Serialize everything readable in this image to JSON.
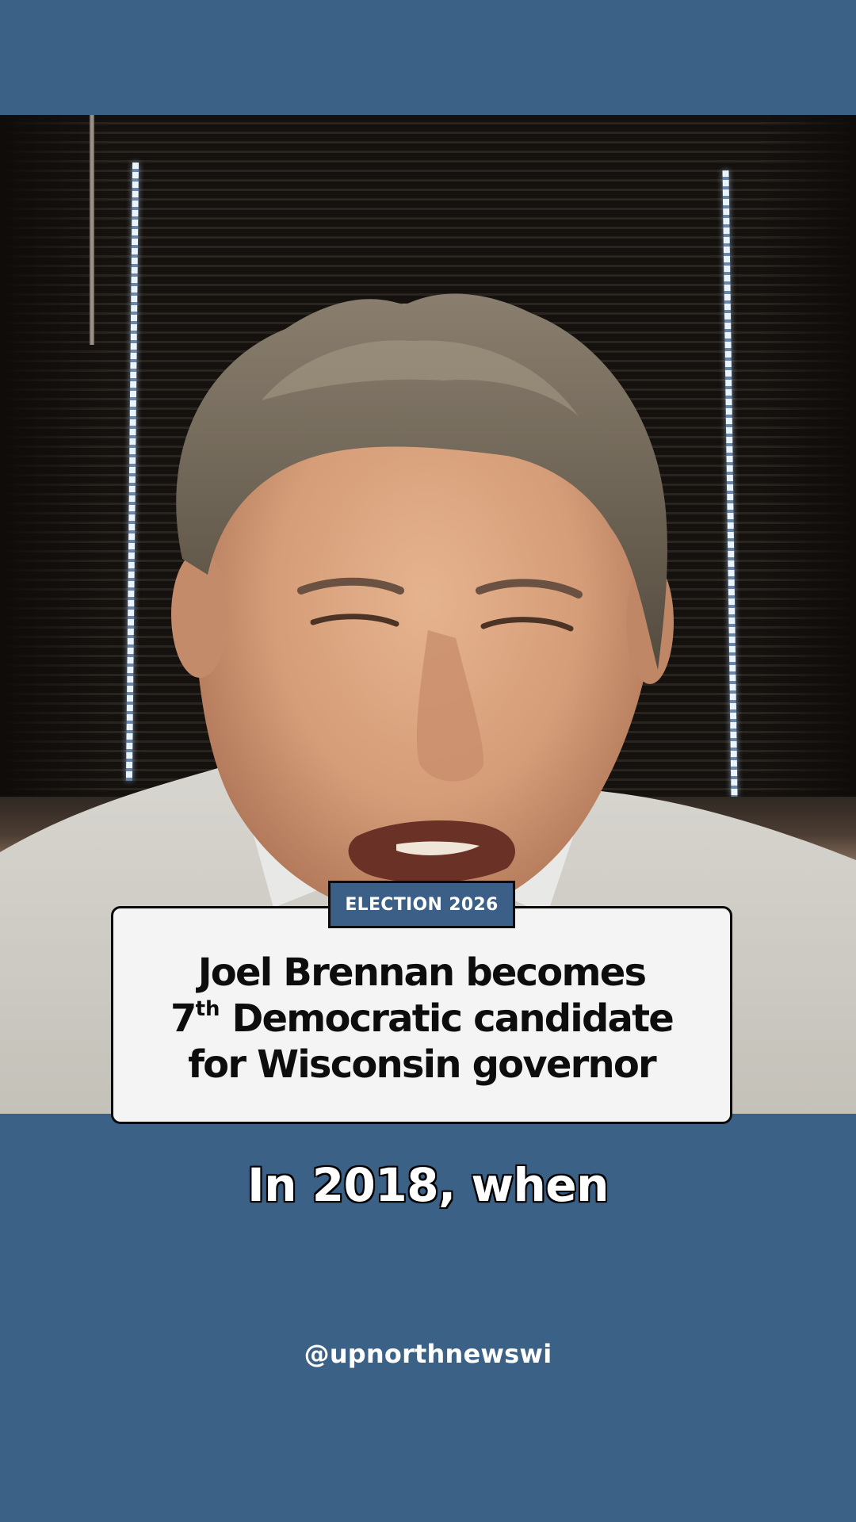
{
  "video": {
    "subject_label": "person speaking on video call"
  },
  "overlay": {
    "tag": "ELECTION 2026",
    "headline_line1": "Joel Brennan becomes",
    "headline_line2_prefix": "7",
    "headline_line2_sup": "th",
    "headline_line2_rest": " Democratic candidate",
    "headline_line3": "for Wisconsin governor"
  },
  "caption": {
    "text": "In 2018, when"
  },
  "footer": {
    "handle": "@upnorthnewswi"
  },
  "colors": {
    "background": "#3c6187",
    "tag_background": "#3b5f86",
    "card_background": "#f4f4f4",
    "text_dark": "#0d0d0d",
    "text_light": "#ffffff"
  }
}
